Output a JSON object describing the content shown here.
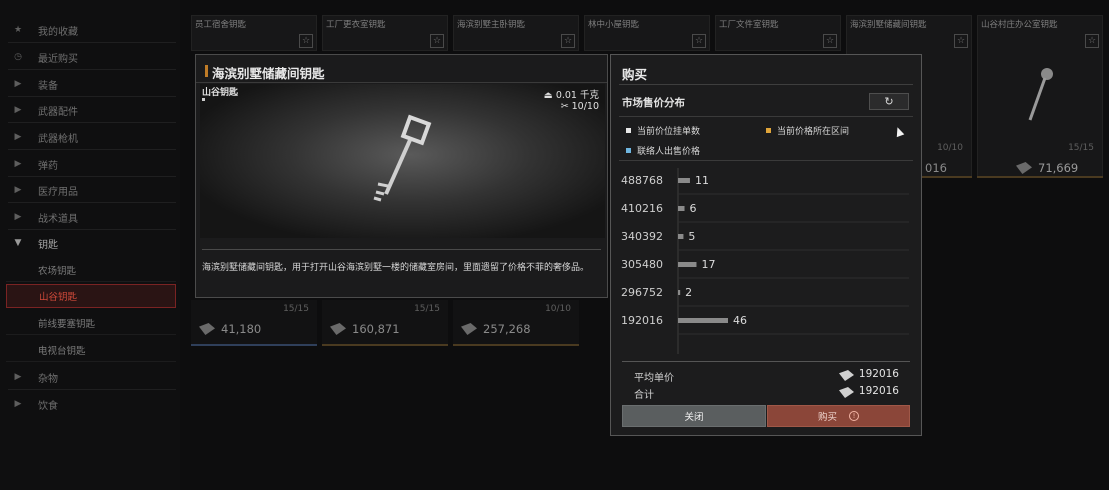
{
  "sidebar": {
    "items": [
      {
        "label": "我的收藏",
        "icon": "star-icon"
      },
      {
        "label": "最近购买",
        "icon": "clock-icon"
      },
      {
        "label": "装备",
        "icon": "chevron-right-icon"
      },
      {
        "label": "武器配件",
        "icon": "chevron-right-icon"
      },
      {
        "label": "武器枪机",
        "icon": "chevron-right-icon"
      },
      {
        "label": "弹药",
        "icon": "chevron-right-icon"
      },
      {
        "label": "医疗用品",
        "icon": "chevron-right-icon"
      },
      {
        "label": "战术道具",
        "icon": "chevron-right-icon"
      },
      {
        "label": "钥匙",
        "icon": "chevron-down-icon"
      }
    ],
    "sub_items": [
      {
        "label": "农场钥匙"
      },
      {
        "label": "山谷钥匙"
      },
      {
        "label": "前线要塞钥匙"
      },
      {
        "label": "电视台钥匙"
      }
    ],
    "items_after": [
      {
        "label": "杂物",
        "icon": "chevron-right-icon"
      },
      {
        "label": "饮食",
        "icon": "chevron-right-icon"
      }
    ]
  },
  "grid": {
    "top_cards": [
      {
        "name": "员工宿舍钥匙"
      },
      {
        "name": "工厂更衣室钥匙"
      },
      {
        "name": "海滨别墅主卧钥匙"
      },
      {
        "name": "林中小屋钥匙"
      },
      {
        "name": "工厂文件室钥匙"
      },
      {
        "name": "海滨别墅储藏间钥匙"
      },
      {
        "name": "山谷村庄办公室钥匙"
      }
    ],
    "right_cards": [
      {
        "durability": "10/10",
        "price": "016"
      },
      {
        "durability": "15/15",
        "price": "71,669"
      }
    ],
    "bottom_cards": [
      {
        "durability": "15/15",
        "price": "41,180"
      },
      {
        "durability": "15/15",
        "price": "160,871"
      },
      {
        "durability": "10/10",
        "price": "257,268"
      }
    ]
  },
  "detail": {
    "title": "海滨别墅储藏间钥匙",
    "category": "山谷钥匙",
    "weight": "0.01 千克",
    "durability": "10/10",
    "description": "海滨别墅储藏间钥匙，用于打开山谷海滨别墅一楼的储藏室房间，里面遗留了价格不菲的奢侈品。"
  },
  "buy": {
    "title": "购买",
    "market_title": "市场售价分布",
    "refresh_icon": "refresh-icon",
    "legend": [
      {
        "label": "当前价位挂单数",
        "color": "#e8e8e8"
      },
      {
        "label": "当前价格所在区间",
        "color": "#e0a53a"
      },
      {
        "label": "联络人出售价格",
        "color": "#6fb6e0"
      }
    ],
    "avg_label": "平均单价",
    "avg_value": "192016",
    "total_label": "合计",
    "total_value": "192016",
    "close_label": "关闭",
    "buy_label": "购买",
    "warn_icon": "!"
  },
  "chart_data": {
    "type": "bar",
    "orientation": "horizontal",
    "categories": [
      "488768",
      "410216",
      "340392",
      "305480",
      "296752",
      "192016"
    ],
    "values": [
      11,
      6,
      5,
      17,
      2,
      46
    ],
    "title": "",
    "xlabel": "",
    "ylabel": "",
    "grid": true
  }
}
